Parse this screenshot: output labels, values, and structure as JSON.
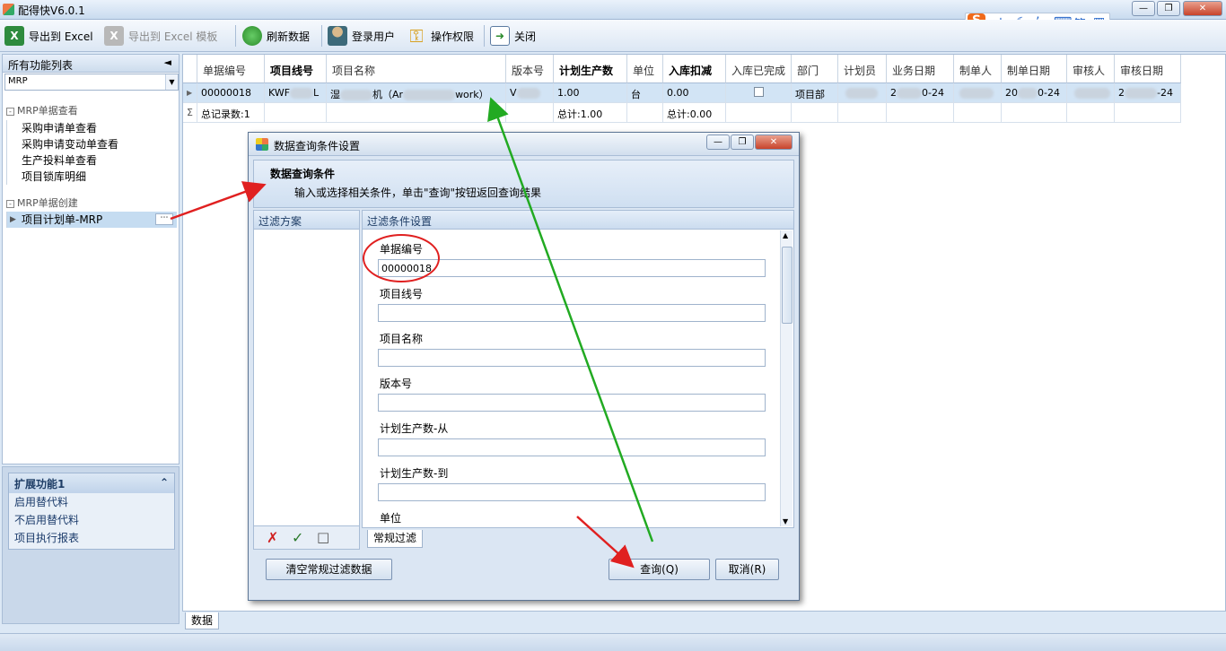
{
  "app": {
    "title": "配得快V6.0.1"
  },
  "ime": {
    "logo": "S",
    "lang": "中",
    "simp": "简"
  },
  "toolbar": {
    "export_excel": "导出到 Excel",
    "export_template": "导出到 Excel 模板",
    "refresh": "刷新数据",
    "login": "登录用户",
    "permissions": "操作权限",
    "close": "关闭"
  },
  "left": {
    "header": "所有功能列表",
    "combo_value": "MRP",
    "group1": "MRP单据查看",
    "group1_items": [
      "采购申请单查看",
      "采购申请变动单查看",
      "生产投料单查看",
      "项目锁库明细"
    ],
    "group2": "MRP单据创建",
    "group2_items": [
      "项目计划单-MRP"
    ]
  },
  "ext": {
    "title": "扩展功能1",
    "items": [
      "启用替代料",
      "不启用替代料",
      "项目执行报表"
    ]
  },
  "grid": {
    "columns": [
      "单据编号",
      "项目线号",
      "项目名称",
      "版本号",
      "计划生产数",
      "单位",
      "入库扣减",
      "入库已完成",
      "部门",
      "计划员",
      "业务日期",
      "制单人",
      "制单日期",
      "审核人",
      "审核日期"
    ],
    "row": {
      "doc_no": "00000018",
      "line_a": "KWF",
      "line_b": "L",
      "name_a": "湿",
      "name_b": "机（Ar",
      "name_c": "work）",
      "version": "V",
      "qty": "1.00",
      "unit": "台",
      "deduct": "0.00",
      "dept": "项目部",
      "biz_date": "0-24",
      "biz_date_prefix": "2",
      "make_date_prefix": "20",
      "make_date": "0-24",
      "audit_date_prefix": "2",
      "audit_date": "-24"
    },
    "summary": {
      "count": "总记录数:1",
      "qty_total": "总计:1.00",
      "deduct_total": "总计:0.00"
    },
    "bottom_tab": "数据"
  },
  "dialog": {
    "title": "数据查询条件设置",
    "header": "数据查询条件",
    "hint": "输入或选择相关条件，单击\"查询\"按钮返回查询结果",
    "left_title": "过滤方案",
    "right_title": "过滤条件设置",
    "fields": [
      {
        "label": "单据编号",
        "value": "00000018"
      },
      {
        "label": "项目线号",
        "value": ""
      },
      {
        "label": "项目名称",
        "value": ""
      },
      {
        "label": "版本号",
        "value": ""
      },
      {
        "label": "计划生产数-从",
        "value": ""
      },
      {
        "label": "计划生产数-到",
        "value": ""
      },
      {
        "label": "单位",
        "value": ""
      }
    ],
    "tab": "常规过滤",
    "clear_btn": "清空常规过滤数据",
    "query_btn": "查询(Q)",
    "cancel_btn": "取消(R)"
  },
  "annotation_colors": {
    "red": "#e02020",
    "green": "#22aa22"
  }
}
